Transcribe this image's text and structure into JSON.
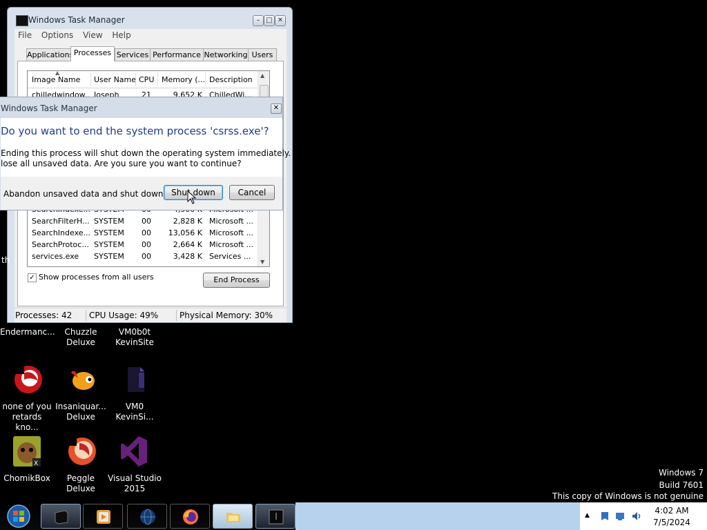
{
  "task_manager": {
    "title": "Windows Task Manager",
    "menu": [
      "File",
      "Options",
      "View",
      "Help"
    ],
    "tabs": [
      "Applications",
      "Processes",
      "Services",
      "Performance",
      "Networking",
      "Users"
    ],
    "active_tab": "Processes",
    "columns": [
      "Image Name",
      "User Name",
      "CPU",
      "Memory (...",
      "Description"
    ],
    "rows": [
      {
        "name": "chilledwindow...",
        "user": "Joseph",
        "cpu": "21",
        "mem": "9,652 K",
        "desc": "ChilledWi..."
      },
      {
        "name": "SearchIndexe...",
        "user": "SYSTEM",
        "cpu": "00",
        "mem": "4,500 K",
        "desc": "Microsoft ..."
      },
      {
        "name": "SearchFilterH...",
        "user": "SYSTEM",
        "cpu": "00",
        "mem": "2,828 K",
        "desc": "Microsoft ..."
      },
      {
        "name": "SearchIndexe...",
        "user": "SYSTEM",
        "cpu": "00",
        "mem": "13,056 K",
        "desc": "Microsoft ..."
      },
      {
        "name": "SearchProtoc...",
        "user": "SYSTEM",
        "cpu": "00",
        "mem": "2,664 K",
        "desc": "Microsoft ..."
      },
      {
        "name": "services.exe",
        "user": "SYSTEM",
        "cpu": "00",
        "mem": "3,428 K",
        "desc": "Services ..."
      }
    ],
    "show_all_label": "Show processes from all users",
    "show_all_checked": "✓",
    "end_process": "End Process",
    "status": {
      "processes": "Processes: 42",
      "cpu": "CPU Usage: 49%",
      "memory": "Physical Memory: 30%"
    }
  },
  "dialog": {
    "title": "Windows Task Manager",
    "heading": "Do you want to end the system process 'csrss.exe'?",
    "body_line1": "Ending this process will shut down the operating system immediately.  You will",
    "body_line2": "lose all unsaved data.  Are you sure you want to continue?",
    "checkbox_label": "Abandon unsaved data and shut down.",
    "shutdown_button": "Shut down",
    "cancel_button": "Cancel"
  },
  "desktop": {
    "left_edge_text": "th",
    "icons": [
      {
        "label1": "Endermanc...",
        "label2": ""
      },
      {
        "label1": "Chuzzle",
        "label2": "Deluxe"
      },
      {
        "label1": "VM0b0t",
        "label2": "KevinSite"
      },
      {
        "label1": "none of you",
        "label2": "retards kno..."
      },
      {
        "label1": "Insaniquar...",
        "label2": "Deluxe"
      },
      {
        "label1": "VM0",
        "label2": "KevinSi..."
      },
      {
        "label1": "ChomikBox",
        "label2": ""
      },
      {
        "label1": "Peggle Deluxe",
        "label2": ""
      },
      {
        "label1": "Visual Studio",
        "label2": "2015"
      }
    ],
    "watermark": {
      "line1": "Windows 7",
      "line2": "Build 7601",
      "line3": "This copy of Windows is not genuine"
    }
  },
  "taskbar": {
    "time": "4:02 AM",
    "date": "7/5/2024",
    "tray_arrow": "▲",
    "buttons": [
      "start-orb",
      "task-manager",
      "media-player",
      "globe",
      "firefox",
      "explorer",
      "window-app"
    ]
  },
  "colors": {
    "heading_blue": "#1f3b8f",
    "taskbar_light": "#b6d2ec",
    "desktop": "#000000"
  }
}
